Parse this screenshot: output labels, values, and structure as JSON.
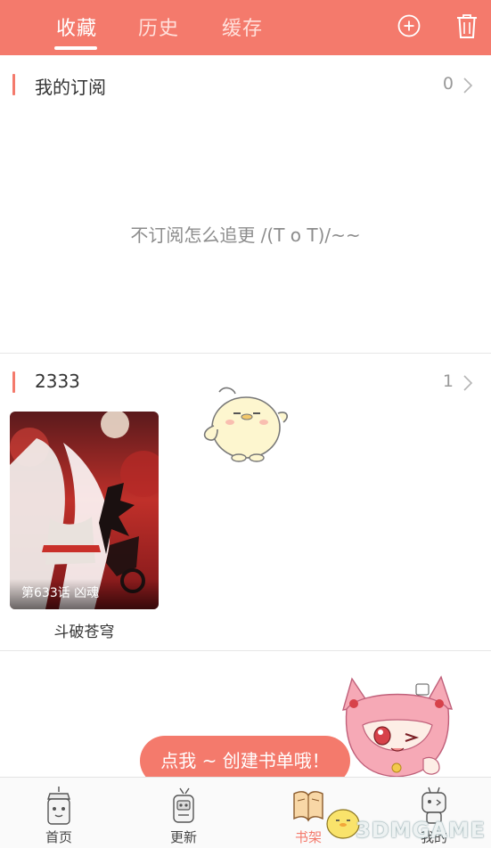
{
  "header": {
    "tabs": [
      {
        "label": "收藏",
        "active": true
      },
      {
        "label": "历史",
        "active": false
      },
      {
        "label": "缓存",
        "active": false
      }
    ],
    "icons": [
      "add-circle-icon",
      "trash-icon"
    ]
  },
  "subscriptions": {
    "title": "我的订阅",
    "count": "0",
    "empty_message": "不订阅怎么追更 /(T o T)/~~"
  },
  "collection": {
    "title": "2333",
    "count": "1",
    "comics": [
      {
        "title": "斗破苍穹",
        "latest_chapter": "第633话 凶魂"
      }
    ]
  },
  "create_booklist": {
    "label": "点我 ~ 创建书单哦！"
  },
  "bottom_nav": {
    "items": [
      {
        "label": "首页",
        "icon": "home-lantern-icon",
        "active": false
      },
      {
        "label": "更新",
        "icon": "update-robot-icon",
        "active": false
      },
      {
        "label": "书架",
        "icon": "bookshelf-icon",
        "active": true
      },
      {
        "label": "我的",
        "icon": "profile-robot-icon",
        "active": false
      }
    ]
  },
  "watermark": "3DMGAME",
  "colors": {
    "accent": "#f47a6c",
    "muted_text": "#8c8c8c",
    "divider": "#e6e6e6"
  }
}
